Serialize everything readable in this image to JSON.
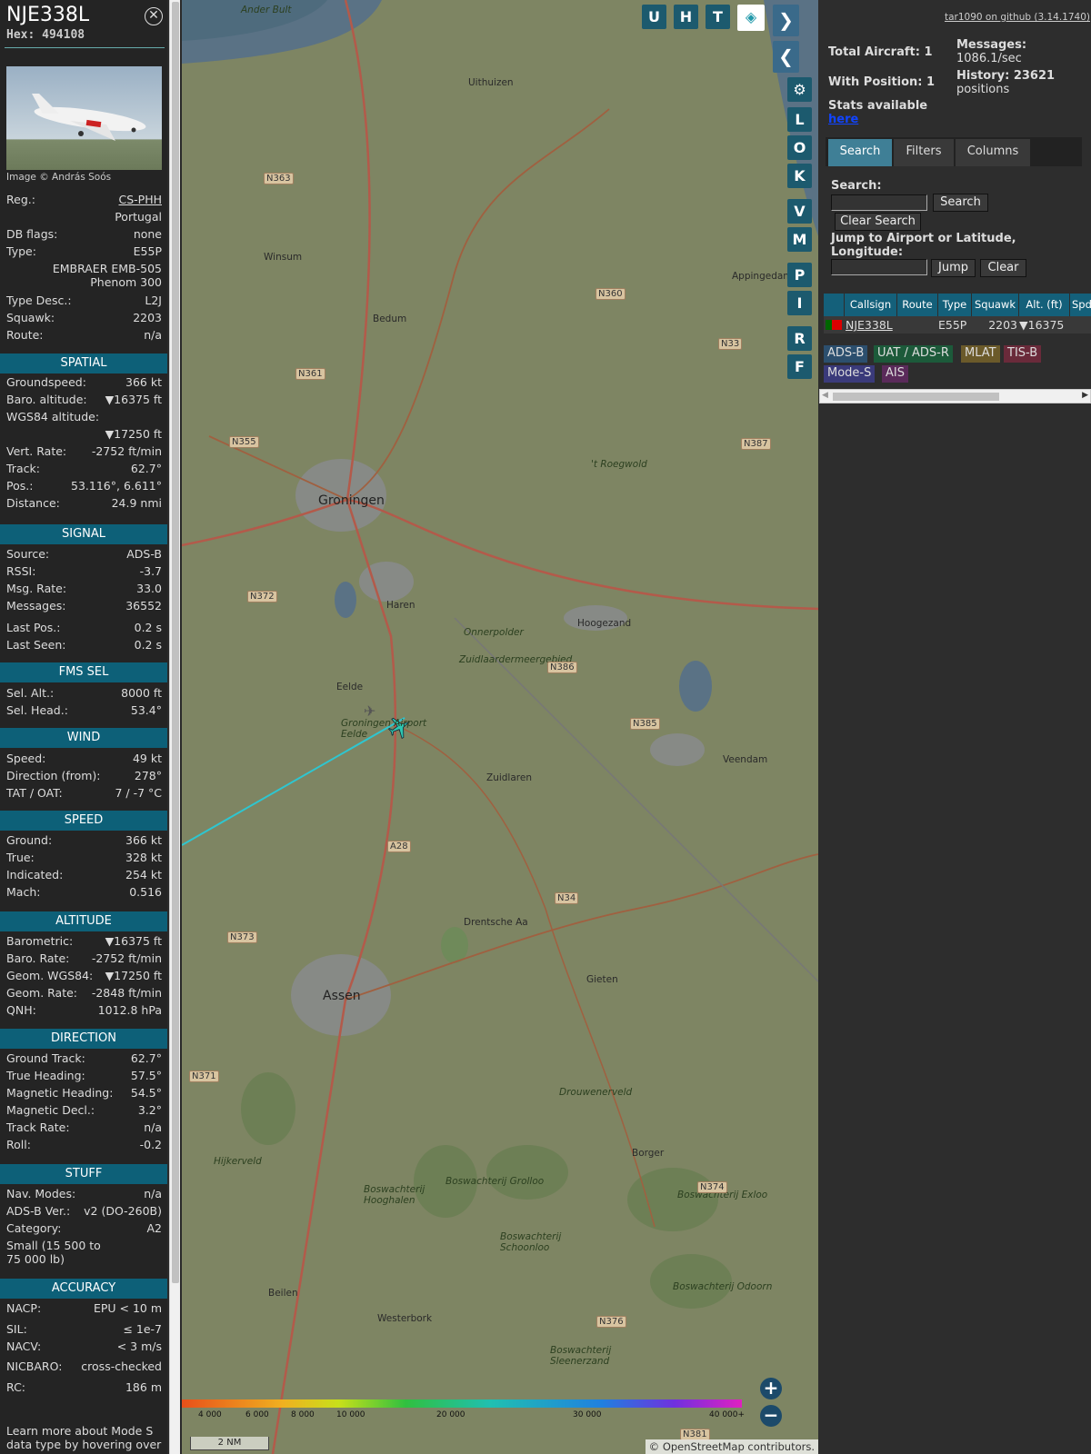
{
  "aircraft": {
    "callsign": "NJE338L",
    "hex": "Hex: 494108",
    "close": "⊗",
    "credit": "Image © András Soós"
  },
  "details": [
    {
      "k": "Reg.:",
      "v": "CS-PHH"
    },
    {
      "k": "",
      "v": "Portugal"
    },
    {
      "k": "DB flags:",
      "v": "none"
    },
    {
      "k": "Type:",
      "v": "E55P"
    },
    {
      "k": "",
      "v": "EMBRAER EMB-505"
    },
    {
      "k": "",
      "v": "Phenom 300"
    },
    {
      "k": "Type Desc.:",
      "v": "L2J"
    },
    {
      "k": "Squawk:",
      "v": "2203"
    },
    {
      "k": "Route:",
      "v": "n/a"
    }
  ],
  "sections": {
    "spatial": {
      "title": "SPATIAL",
      "rows": [
        {
          "k": "Groundspeed:",
          "v": "366 kt"
        },
        {
          "k": "Baro. altitude:",
          "v": "▼16375 ft"
        },
        {
          "k": "WGS84 altitude:",
          "v": ""
        },
        {
          "k": "",
          "v": "▼17250 ft"
        },
        {
          "k": "Vert. Rate:",
          "v": "-2752 ft/min"
        },
        {
          "k": "Track:",
          "v": "62.7°"
        },
        {
          "k": "Pos.:",
          "v": "53.116°, 6.611°"
        },
        {
          "k": "Distance:",
          "v": "24.9 nmi"
        }
      ]
    },
    "signal": {
      "title": "SIGNAL",
      "rows": [
        {
          "k": "Source:",
          "v": "ADS-B"
        },
        {
          "k": "RSSI:",
          "v": "-3.7"
        },
        {
          "k": "Msg. Rate:",
          "v": "33.0"
        },
        {
          "k": "Messages:",
          "v": "36552"
        },
        {
          "k": "Last Pos.:",
          "v": "0.2 s"
        },
        {
          "k": "Last Seen:",
          "v": "0.2 s"
        }
      ]
    },
    "fms": {
      "title": "FMS SEL",
      "rows": [
        {
          "k": "Sel. Alt.:",
          "v": "8000 ft"
        },
        {
          "k": "Sel. Head.:",
          "v": "53.4°"
        }
      ]
    },
    "wind": {
      "title": "WIND",
      "rows": [
        {
          "k": "Speed:",
          "v": "49 kt"
        },
        {
          "k": "Direction (from):",
          "v": "278°"
        },
        {
          "k": "TAT / OAT:",
          "v": "7 / -7 °C"
        }
      ]
    },
    "speed": {
      "title": "SPEED",
      "rows": [
        {
          "k": "Ground:",
          "v": "366 kt"
        },
        {
          "k": "True:",
          "v": "328 kt"
        },
        {
          "k": "Indicated:",
          "v": "254 kt"
        },
        {
          "k": "Mach:",
          "v": "0.516"
        }
      ]
    },
    "altitude": {
      "title": "ALTITUDE",
      "rows": [
        {
          "k": "Barometric:",
          "v": "▼16375 ft"
        },
        {
          "k": "Baro. Rate:",
          "v": "-2752 ft/min"
        },
        {
          "k": "Geom. WGS84:",
          "v": "▼17250 ft"
        },
        {
          "k": "Geom. Rate:",
          "v": "-2848 ft/min"
        },
        {
          "k": "QNH:",
          "v": "1012.8 hPa"
        }
      ]
    },
    "direction": {
      "title": "DIRECTION",
      "rows": [
        {
          "k": "Ground Track:",
          "v": "62.7°"
        },
        {
          "k": "True Heading:",
          "v": "57.5°"
        },
        {
          "k": "Magnetic Heading:",
          "v": "54.5°"
        },
        {
          "k": "Magnetic Decl.:",
          "v": "3.2°"
        },
        {
          "k": "Track Rate:",
          "v": "n/a"
        },
        {
          "k": "Roll:",
          "v": "-0.2"
        }
      ]
    },
    "stuff": {
      "title": "STUFF",
      "rows": [
        {
          "k": "Nav. Modes:",
          "v": "n/a"
        },
        {
          "k": "ADS-B Ver.:",
          "v": "v2 (DO-260B)"
        },
        {
          "k": "Category:",
          "v": "A2"
        },
        {
          "k": "Small (15 500 to",
          "v": ""
        },
        {
          "k": "75 000 lb)",
          "v": ""
        }
      ]
    },
    "accuracy": {
      "title": "ACCURACY",
      "rows": [
        {
          "k": "NACP:",
          "v": "EPU < 10 m"
        },
        {
          "k": "SIL:",
          "v": "≤ 1e-7"
        },
        {
          "k": "NACV:",
          "v": "< 3 m/s"
        },
        {
          "k": "NICBARO:",
          "v": "cross-checked"
        },
        {
          "k": "RC:",
          "v": "186 m"
        }
      ]
    }
  },
  "footer": "Learn more about Mode S data type by hovering over",
  "map": {
    "buttons": {
      "u": "U",
      "h": "H",
      "t": "T",
      "l": "L",
      "o": "O",
      "k": "K",
      "v": "V",
      "m": "M",
      "p": "P",
      "i": "I",
      "r": "R",
      "f": "F"
    },
    "labels": [
      "Uithuizen",
      "Winsum",
      "Bedum",
      "Appingedam",
      "Groningen",
      "Haren",
      "Hoogezand",
      "Eelde",
      "Zuidlaren",
      "Veendam",
      "Assen",
      "Gieten",
      "Borger",
      "Beilen",
      "Westerbork",
      "Drentsche Aa",
      "Groningen Airport Eelde",
      "'t Roegwold",
      "Onnerpolder",
      "Zuidlaardermeergebied",
      "Drouwenerveld",
      "Hijkerveld",
      "Boswachterij Hooghalen",
      "Boswachterij Grolloo",
      "Boswachterij Schoonloo",
      "Boswachterij Exloo",
      "Boswachterij Odoorn",
      "Boswachterij Sleenerzand",
      "Ander Bult",
      "N363",
      "N361",
      "N355",
      "N372",
      "N360",
      "N33",
      "N387",
      "N386",
      "N385",
      "N34",
      "N373",
      "N371",
      "A28",
      "N374",
      "N376",
      "N381"
    ],
    "altitude_scale": [
      "4 000",
      "6 000",
      "8 000",
      "10 000",
      "20 000",
      "30 000",
      "40 000+"
    ],
    "scale": "2 NM",
    "zoom_in": "+",
    "zoom_out": "−",
    "attribution": "© OpenStreetMap contributors."
  },
  "right": {
    "github": "tar1090 on github (3.14.1740)",
    "total": "Total Aircraft: 1",
    "withpos": "With Position: 1",
    "msgs_k": "Messages:",
    "msgs_v": "1086.1/sec",
    "hist_k": "History: 23621",
    "hist_v": "positions",
    "stats": "Stats available",
    "here": "here",
    "tabs": [
      "Search",
      "Filters",
      "Columns"
    ],
    "search_label": "Search:",
    "search_btn": "Search",
    "clear_search": "Clear Search",
    "jump_label": "Jump to Airport or Latitude, Longitude:",
    "jump_btn": "Jump",
    "clear_btn": "Clear",
    "columns": [
      "Callsign",
      "Route",
      "Type",
      "Squawk",
      "Alt. (ft)",
      "Spd"
    ],
    "row": {
      "callsign": "NJE338L",
      "route": "",
      "type": "E55P",
      "squawk": "2203",
      "alt": "▼16375"
    },
    "badges": [
      "ADS-B",
      "UAT / ADS-R",
      "MLAT",
      "TIS-B",
      "Mode-S",
      "AIS"
    ],
    "colors": {
      "adsb": "#2c4f6e",
      "uat": "#1c5a3a",
      "mlat": "#6b5a2a",
      "tisb": "#6a2a3a",
      "modes": "#3a3a7a",
      "ais": "#5a2a5a"
    }
  }
}
